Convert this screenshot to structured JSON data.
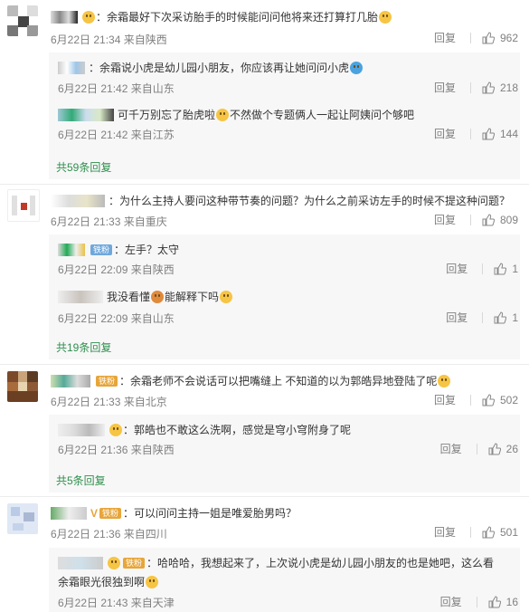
{
  "common": {
    "reply_label": "回复"
  },
  "threads": [
    {
      "comment": {
        "name": "：",
        "text": "余霜最好下次采访胎手的时候能问问他将来还打算打几胎",
        "time": "6月22日 21:34 来自陕西",
        "likes": "962"
      },
      "replies": [
        {
          "name": "：",
          "text": "余霜说小虎是幼儿园小朋友，你应该再让她问问小虎",
          "time": "6月22日 21:42 来自山东",
          "likes": "218"
        },
        {
          "name": "：",
          "text": "可千万别忘了胎虎啦",
          "text2": "不然做个专题俩人一起让阿姨问个够吧",
          "time": "6月22日 21:42 来自江苏",
          "likes": "144"
        }
      ],
      "more": "共59条回复"
    },
    {
      "comment": {
        "name": "：",
        "text": "为什么主持人要问这种带节奏的问题？为什么之前采访左手的时候不提这种问题？",
        "time": "6月22日 21:33 来自重庆",
        "likes": "809"
      },
      "replies": [
        {
          "name": "：",
          "badge": "铁粉",
          "text": "左手？太守",
          "time": "6月22日 22:09 来自陕西",
          "likes": "1"
        },
        {
          "name": "",
          "text": "我没看懂",
          "text2": "能解释下吗",
          "time": "6月22日 22:09 来自山东",
          "likes": "1"
        }
      ],
      "more": "共19条回复"
    },
    {
      "comment": {
        "name": "：",
        "badge": "铁粉",
        "text": "余霜老师不会说话可以把嘴缝上 不知道的以为郭皓异地登陆了呢",
        "time": "6月22日 21:33 来自北京",
        "likes": "502"
      },
      "replies": [
        {
          "name": "：",
          "text": "郭皓也不敢这么洗啊，感觉是穹小穹附身了呢",
          "time": "6月22日 21:36 来自陕西",
          "likes": "26"
        }
      ],
      "more": "共5条回复"
    },
    {
      "comment": {
        "name": "V",
        "badge": "铁粉",
        "text": "：可以问问主持一姐是唯爱胎男吗？",
        "time": "6月22日 21:36 来自四川",
        "likes": "501"
      },
      "replies": [
        {
          "name": "",
          "badge": "铁粉",
          "text": "：哈哈哈，我想起来了，上次说小虎是幼儿园小朋友的也是她吧，这么看",
          "text2": "余霜眼光很独到啊",
          "time": "6月22日 21:43 来自天津",
          "likes": "16"
        }
      ]
    }
  ]
}
